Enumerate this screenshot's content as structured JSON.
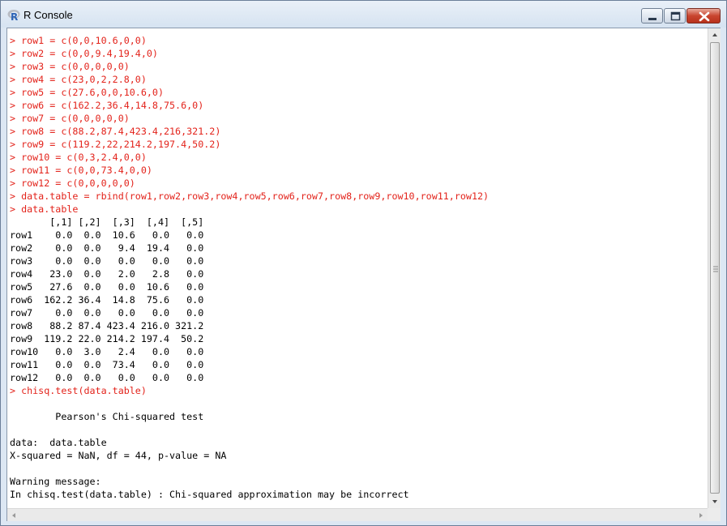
{
  "window": {
    "title": "R Console"
  },
  "console": {
    "lines": [
      {
        "type": "input",
        "text": "> row1 = c(0,0,10.6,0,0)"
      },
      {
        "type": "input",
        "text": "> row2 = c(0,0,9.4,19.4,0)"
      },
      {
        "type": "input",
        "text": "> row3 = c(0,0,0,0,0)"
      },
      {
        "type": "input",
        "text": "> row4 = c(23,0,2,2.8,0)"
      },
      {
        "type": "input",
        "text": "> row5 = c(27.6,0,0,10.6,0)"
      },
      {
        "type": "input",
        "text": "> row6 = c(162.2,36.4,14.8,75.6,0)"
      },
      {
        "type": "input",
        "text": "> row7 = c(0,0,0,0,0)"
      },
      {
        "type": "input",
        "text": "> row8 = c(88.2,87.4,423.4,216,321.2)"
      },
      {
        "type": "input",
        "text": "> row9 = c(119.2,22,214.2,197.4,50.2)"
      },
      {
        "type": "input",
        "text": "> row10 = c(0,3,2.4,0,0)"
      },
      {
        "type": "input",
        "text": "> row11 = c(0,0,73.4,0,0)"
      },
      {
        "type": "input",
        "text": "> row12 = c(0,0,0,0,0)"
      },
      {
        "type": "input",
        "text": "> data.table = rbind(row1,row2,row3,row4,row5,row6,row7,row8,row9,row10,row11,row12)"
      },
      {
        "type": "input",
        "text": "> data.table"
      },
      {
        "type": "output",
        "text": "       [,1] [,2]  [,3]  [,4]  [,5]"
      },
      {
        "type": "output",
        "text": "row1    0.0  0.0  10.6   0.0   0.0"
      },
      {
        "type": "output",
        "text": "row2    0.0  0.0   9.4  19.4   0.0"
      },
      {
        "type": "output",
        "text": "row3    0.0  0.0   0.0   0.0   0.0"
      },
      {
        "type": "output",
        "text": "row4   23.0  0.0   2.0   2.8   0.0"
      },
      {
        "type": "output",
        "text": "row5   27.6  0.0   0.0  10.6   0.0"
      },
      {
        "type": "output",
        "text": "row6  162.2 36.4  14.8  75.6   0.0"
      },
      {
        "type": "output",
        "text": "row7    0.0  0.0   0.0   0.0   0.0"
      },
      {
        "type": "output",
        "text": "row8   88.2 87.4 423.4 216.0 321.2"
      },
      {
        "type": "output",
        "text": "row9  119.2 22.0 214.2 197.4  50.2"
      },
      {
        "type": "output",
        "text": "row10   0.0  3.0   2.4   0.0   0.0"
      },
      {
        "type": "output",
        "text": "row11   0.0  0.0  73.4   0.0   0.0"
      },
      {
        "type": "output",
        "text": "row12   0.0  0.0   0.0   0.0   0.0"
      },
      {
        "type": "input",
        "text": "> chisq.test(data.table)"
      },
      {
        "type": "output",
        "text": ""
      },
      {
        "type": "output",
        "text": "        Pearson's Chi-squared test"
      },
      {
        "type": "output",
        "text": ""
      },
      {
        "type": "output",
        "text": "data:  data.table"
      },
      {
        "type": "output",
        "text": "X-squared = NaN, df = 44, p-value = NA"
      },
      {
        "type": "output",
        "text": ""
      },
      {
        "type": "output",
        "text": "Warning message:"
      },
      {
        "type": "output",
        "text": "In chisq.test(data.table) : Chi-squared approximation may be incorrect"
      }
    ]
  },
  "icons": {
    "app": "r-logo-icon",
    "minimize": "minimize-icon",
    "maximize": "maximize-icon",
    "close": "close-icon",
    "scroll_up": "scroll-up-arrow-icon",
    "scroll_down": "scroll-down-arrow-icon",
    "scroll_left": "scroll-left-arrow-icon",
    "scroll_right": "scroll-right-arrow-icon"
  },
  "colors": {
    "input_text": "#e3231b",
    "output_text": "#000000",
    "close_button": "#c9452f"
  }
}
